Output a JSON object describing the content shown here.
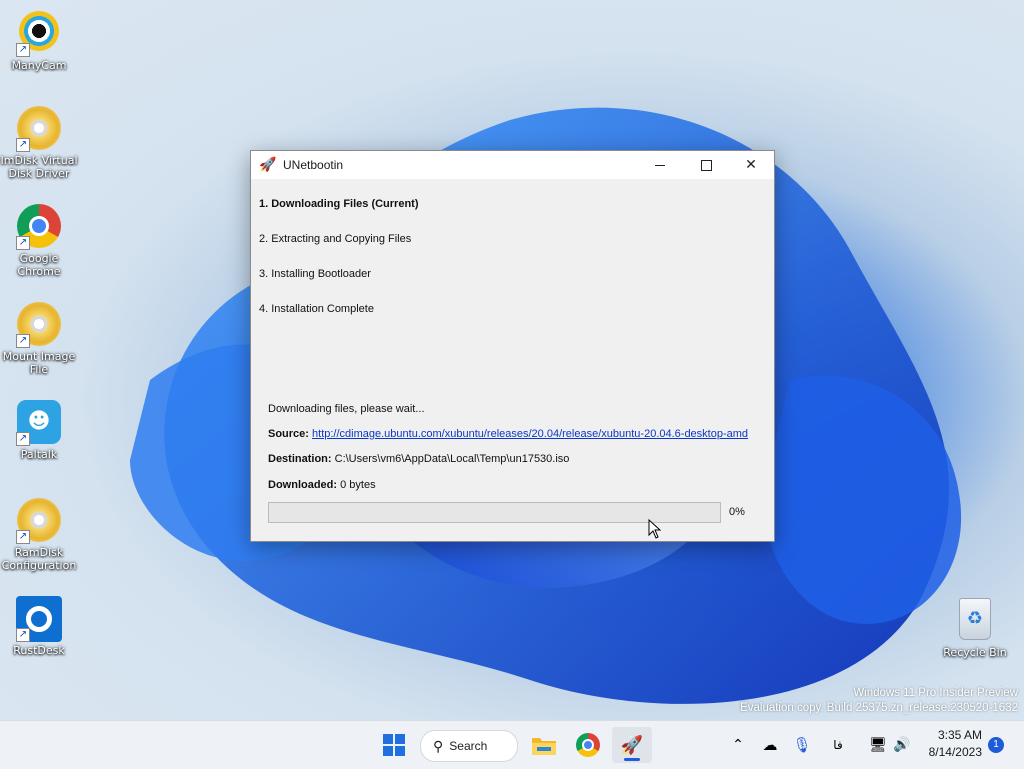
{
  "desktop": {
    "icons": [
      {
        "label": "ManyCam",
        "icon": "manycam-icon"
      },
      {
        "label": "ImDisk Virtual Disk Driver",
        "icon": "disc-icon"
      },
      {
        "label": "Google Chrome",
        "icon": "chrome-icon"
      },
      {
        "label": "Mount Image File",
        "icon": "disc-icon"
      },
      {
        "label": "Paltalk",
        "icon": "paltalk-icon"
      },
      {
        "label": "RamDisk Configuration",
        "icon": "disc-icon"
      },
      {
        "label": "RustDesk",
        "icon": "rustdesk-icon"
      }
    ],
    "recycle_bin": {
      "label": "Recycle Bin",
      "icon": "recycle-bin-icon"
    },
    "watermark": {
      "line1": "Windows 11 Pro Insider Preview",
      "line2": "Evaluation copy. Build 25375.zn_release.230520-1632"
    }
  },
  "window": {
    "title": "UNetbootin",
    "title_icon": "rocket-icon",
    "controls": {
      "minimize": "minimize-icon",
      "maximize": "maximize-icon",
      "close": "close-icon"
    },
    "steps": [
      "1. Downloading Files (Current)",
      "2. Extracting and Copying Files",
      "3. Installing Bootloader",
      "4. Installation Complete"
    ],
    "status": "Downloading files, please wait...",
    "source_label": "Source:",
    "source_url": "http://cdimage.ubuntu.com/xubuntu/releases/20.04/release/xubuntu-20.04.6-desktop-amd",
    "destination_label": "Destination:",
    "destination_value": "C:\\Users\\vm6\\AppData\\Local\\Temp\\un17530.iso",
    "downloaded_label": "Downloaded:",
    "downloaded_value": "0 bytes",
    "progress_percent": 0,
    "progress_text": "0%"
  },
  "taskbar": {
    "start_icon": "windows-start-icon",
    "search_label": "Search",
    "apps": [
      "file-explorer-icon",
      "chrome-icon",
      "unetbootin-icon"
    ],
    "tray": {
      "chevron": "chevron-up-icon",
      "language": "فا",
      "time": "3:35 AM",
      "date": "8/14/2023",
      "notification_count": "1"
    }
  },
  "colors": {
    "accent": "#1d5bd8",
    "link": "#0b37c8",
    "window_bg": "#f0f0f0",
    "taskbar_bg": "#eef1f5"
  }
}
